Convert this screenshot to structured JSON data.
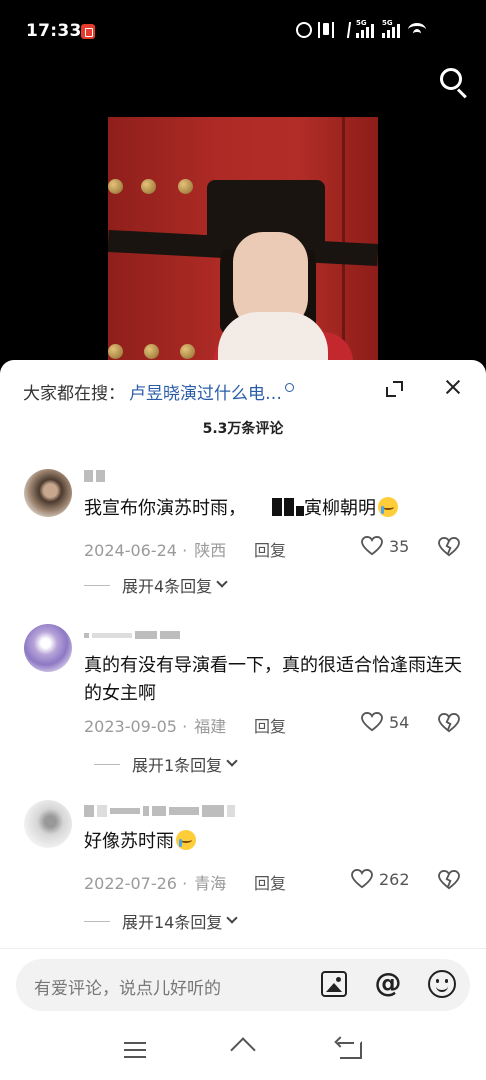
{
  "status_bar": {
    "time": "17:33",
    "network": "5G"
  },
  "sheet": {
    "hot_search_label": "大家都在搜：",
    "hot_search_term": "卢昱晓演过什么电…",
    "comment_count": "5.3万条评论"
  },
  "comments": [
    {
      "text_before": "我宣布你演苏时雨，",
      "text_after": "寅柳朝明",
      "date": "2024-06-24",
      "location": "陕西",
      "reply_label": "回复",
      "likes": "35",
      "replies_label": "展开4条回复"
    },
    {
      "text": "真的有没有导演看一下，真的很适合恰逢雨连天的女主啊",
      "date": "2023-09-05",
      "location": "福建",
      "reply_label": "回复",
      "likes": "54",
      "replies_label": "展开1条回复"
    },
    {
      "text": "好像苏时雨",
      "date": "2022-07-26",
      "location": "青海",
      "reply_label": "回复",
      "likes": "262",
      "replies_label": "展开14条回复"
    }
  ],
  "input": {
    "placeholder": "有爱评论，说点儿好听的"
  },
  "colors": {
    "accent_link": "#2a5da8",
    "badge_red": "#e63c2e",
    "door_red": "#ad2a25"
  }
}
